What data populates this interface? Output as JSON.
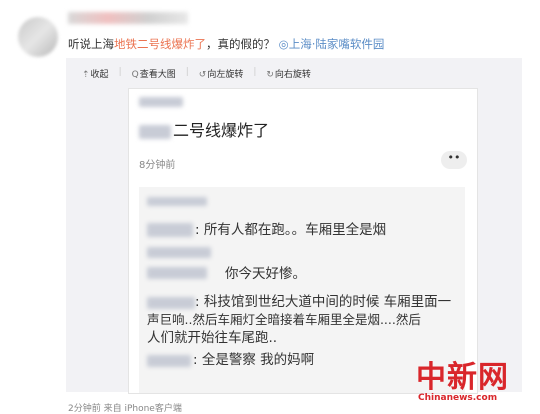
{
  "post": {
    "prefix": "听说上海",
    "highlight": "地铁二号线爆炸了",
    "suffix": "，真的假的？",
    "location": "◎上海·陆家嘴软件园"
  },
  "toolbar": {
    "collapse": "收起",
    "view_large": "查看大图",
    "rotate_left": "向左旋转",
    "rotate_right": "向右旋转"
  },
  "screenshot": {
    "title": "二号线爆炸了",
    "time": "8分钟前",
    "more": "••",
    "lines": [
      ": 所有人都在跑。。车厢里全是烟",
      "你今天好惨。",
      ": 科技馆到世纪大道中间的时候 车厢里面一",
      "声巨响..然后车厢灯全暗接着车厢里全是烟....然后",
      "人们就开始往车尾跑..",
      ": 全是警察 我的妈啊"
    ]
  },
  "footer": "2分钟前 来自 iPhone客户端",
  "watermark": {
    "cn": "中新网",
    "en": "Chinanews.com"
  }
}
